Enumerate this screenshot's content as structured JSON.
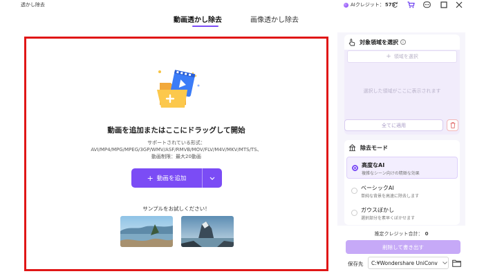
{
  "app": {
    "title": "透かし除去"
  },
  "header": {
    "credits_label": "AIクレジット：",
    "credits_value": "575"
  },
  "tabs": [
    {
      "label": "動画透かし除去",
      "active": true
    },
    {
      "label": "画像透かし除去",
      "active": false
    }
  ],
  "drop_area": {
    "title": "動画を追加またはここにドラッグして開始",
    "formats_label": "サポートされている形式：",
    "formats": "AVI/MP4/MPG/MPEG/3GP/WMV/ASF/RMVB/MOV/FLV/M4V/MKV/MTS/TS、",
    "limit": "動画制限：最大20動画",
    "add_button": "動画を追加",
    "sample_label": "サンプルをお試しください！"
  },
  "panel": {
    "select_title": "対象領域を選択",
    "add_region": "領域を選択",
    "region_placeholder": "選択した領域がここに表示されます",
    "apply_all": "全てに適用",
    "mode_title": "除去モード",
    "modes": [
      {
        "title": "高度なAI",
        "desc": "複雑なシーン向けの精緻な効果",
        "selected": true
      },
      {
        "title": "ベーシックAI",
        "desc": "単純な背景を高速に除去します",
        "selected": false
      },
      {
        "title": "ガウスぼかし",
        "desc": "選択部分を素早くぼかせます",
        "selected": false
      }
    ]
  },
  "footer": {
    "estimate_label": "推定クレジット合計：",
    "estimate_value": "0",
    "remove_button": "削除して書き出す",
    "save_label": "保存先",
    "save_path": "C:¥Wondershare UniConv"
  },
  "colors": {
    "accent": "#7b4cf5",
    "highlight_border": "#e01616",
    "disabled_accent": "#c6a9f7"
  },
  "icons": [
    "credit-gem-icon",
    "refresh-icon",
    "cart-icon",
    "chat-icon",
    "maximize-icon",
    "close-icon",
    "hand-pointer-icon",
    "info-icon",
    "trash-icon",
    "removal-mode-icon",
    "chevron-down-icon",
    "folder-icon",
    "folder-add-icon"
  ]
}
